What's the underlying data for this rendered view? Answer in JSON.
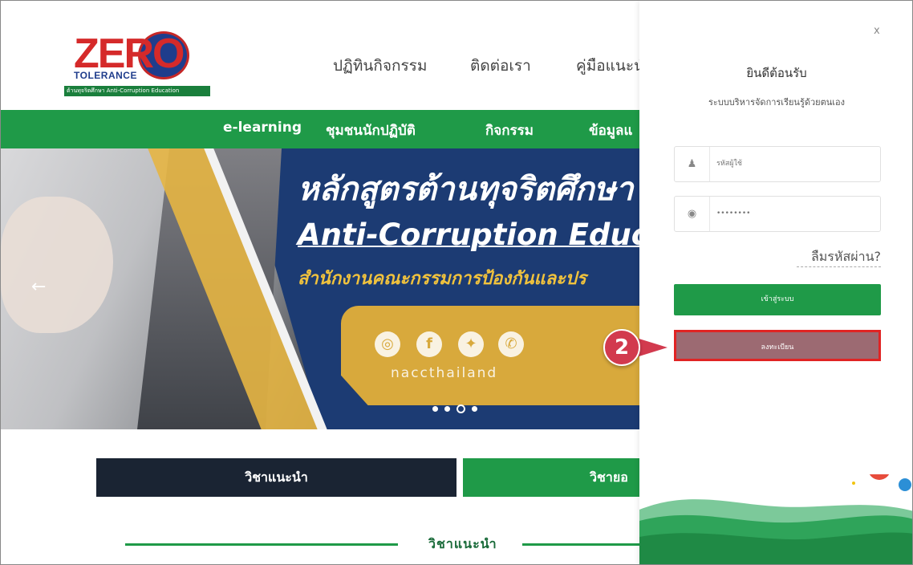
{
  "header": {
    "logo": {
      "main_text": "ZERO",
      "sub_text": "TOLERANCE",
      "tagline": "ต้านทุจริตศึกษา Anti-Corruption Education"
    },
    "nav": [
      "ปฏิทินกิจกรรม",
      "ติดต่อเรา",
      "คู่มือแนะนำ"
    ]
  },
  "green_nav": [
    "e-learning",
    "ชุมชนนักปฏิบัติ",
    "กิจกรรม",
    "ข้อมูลแ"
  ],
  "banner": {
    "title_th": "หลักสูตรต้านทุจริตศึกษา",
    "title_en": "Anti-Corruption Educa",
    "org": "สำนักงานคณะกรรมการป้องกันและปร",
    "handle": "naccthailand",
    "social_icons": [
      "instagram-icon",
      "facebook-icon",
      "twitter-icon",
      "whatsapp-icon"
    ],
    "slides": 4,
    "active_slide": 3
  },
  "tabs": {
    "tab1": "วิชาแนะนำ",
    "tab2": "วิชายอ"
  },
  "section_title": "วิชาแนะนำ",
  "login_panel": {
    "close": "x",
    "welcome": "ยินดีต้อนรับ",
    "subtitle": "ระบบบริหารจัดการเรียนรู้ด้วยตนเอง",
    "username_placeholder": "รหัสผู้ใช้",
    "password_value": "••••••••",
    "forgot": "ลืมรหัสผ่าน?",
    "login_button": "เข้าสู่ระบบ",
    "register_button": "ลงทะเบียน"
  },
  "callout": {
    "number": "2"
  },
  "colors": {
    "green": "#1f9a48",
    "dark_navy": "#1a2433",
    "banner_blue": "#1c3b73",
    "gold": "#d8a93c",
    "register_bg": "#9c6a72",
    "highlight_red": "#e02424",
    "callout": "#d23a4e"
  }
}
